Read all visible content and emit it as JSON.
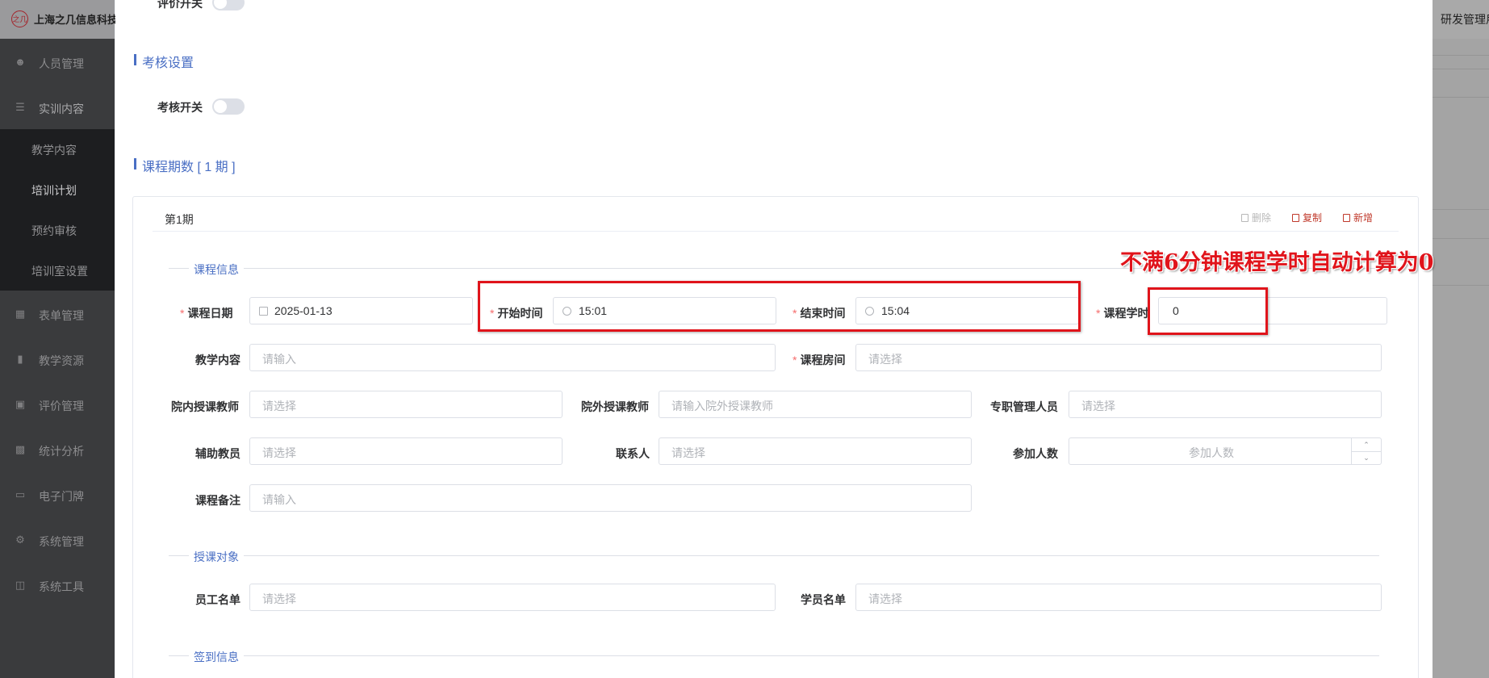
{
  "app": {
    "logo_text": "之几",
    "company": "上海之几信息科技有",
    "header_right": "研发管理用"
  },
  "sidebar": {
    "items": [
      {
        "label": "人员管理",
        "icon": "user-icon"
      },
      {
        "label": "实训内容",
        "icon": "tree-icon"
      },
      {
        "label": "表单管理",
        "icon": "form-icon"
      },
      {
        "label": "教学资源",
        "icon": "resource-icon"
      },
      {
        "label": "评价管理",
        "icon": "evaluate-icon"
      },
      {
        "label": "统计分析",
        "icon": "chart-icon"
      },
      {
        "label": "电子门牌",
        "icon": "monitor-icon"
      },
      {
        "label": "系统管理",
        "icon": "gear-icon"
      },
      {
        "label": "系统工具",
        "icon": "toolbox-icon"
      }
    ],
    "sub_items": [
      {
        "label": "教学内容"
      },
      {
        "label": "培训计划",
        "active": true
      },
      {
        "label": "预约审核"
      },
      {
        "label": "培训室设置"
      }
    ]
  },
  "modal": {
    "top_switch_label": "评价开关",
    "assess_section_title": "考核设置",
    "assess_switch_label": "考核开关",
    "periods_section_title": "课程期数 [ 1 期 ]",
    "period": {
      "title": "第1期",
      "actions": {
        "delete": "删除",
        "copy": "复制",
        "add": "新增"
      },
      "course_info_title": "课程信息",
      "course_date": {
        "label": "课程日期",
        "value": "2025-01-13"
      },
      "start_time": {
        "label": "开始时间",
        "value": "15:01"
      },
      "end_time": {
        "label": "结束时间",
        "value": "15:04"
      },
      "course_hours": {
        "label": "课程学时",
        "value": "0"
      },
      "teaching_content": {
        "label": "教学内容",
        "placeholder": "请输入"
      },
      "course_room": {
        "label": "课程房间",
        "placeholder": "请选择"
      },
      "inner_teacher": {
        "label": "院内授课教师",
        "placeholder": "请选择"
      },
      "outer_teacher": {
        "label": "院外授课教师",
        "placeholder": "请输入院外授课教师"
      },
      "manager": {
        "label": "专职管理人员",
        "placeholder": "请选择"
      },
      "assistant": {
        "label": "辅助教员",
        "placeholder": "请选择"
      },
      "contact": {
        "label": "联系人",
        "placeholder": "请选择"
      },
      "participants": {
        "label": "参加人数",
        "placeholder": "参加人数"
      },
      "remark": {
        "label": "课程备注",
        "placeholder": "请输入"
      },
      "audience_title": "授课对象",
      "staff_list": {
        "label": "员工名单",
        "placeholder": "请选择"
      },
      "student_list": {
        "label": "学员名单",
        "placeholder": "请选择"
      },
      "signin_title": "签到信息"
    }
  },
  "annotation": {
    "text": "不满6分钟课程学时自动计算为0",
    "color": "#e0141b"
  },
  "colors": {
    "accent": "#4a6fc4",
    "required": "#f56c6c",
    "danger_action": "#c0392b"
  }
}
